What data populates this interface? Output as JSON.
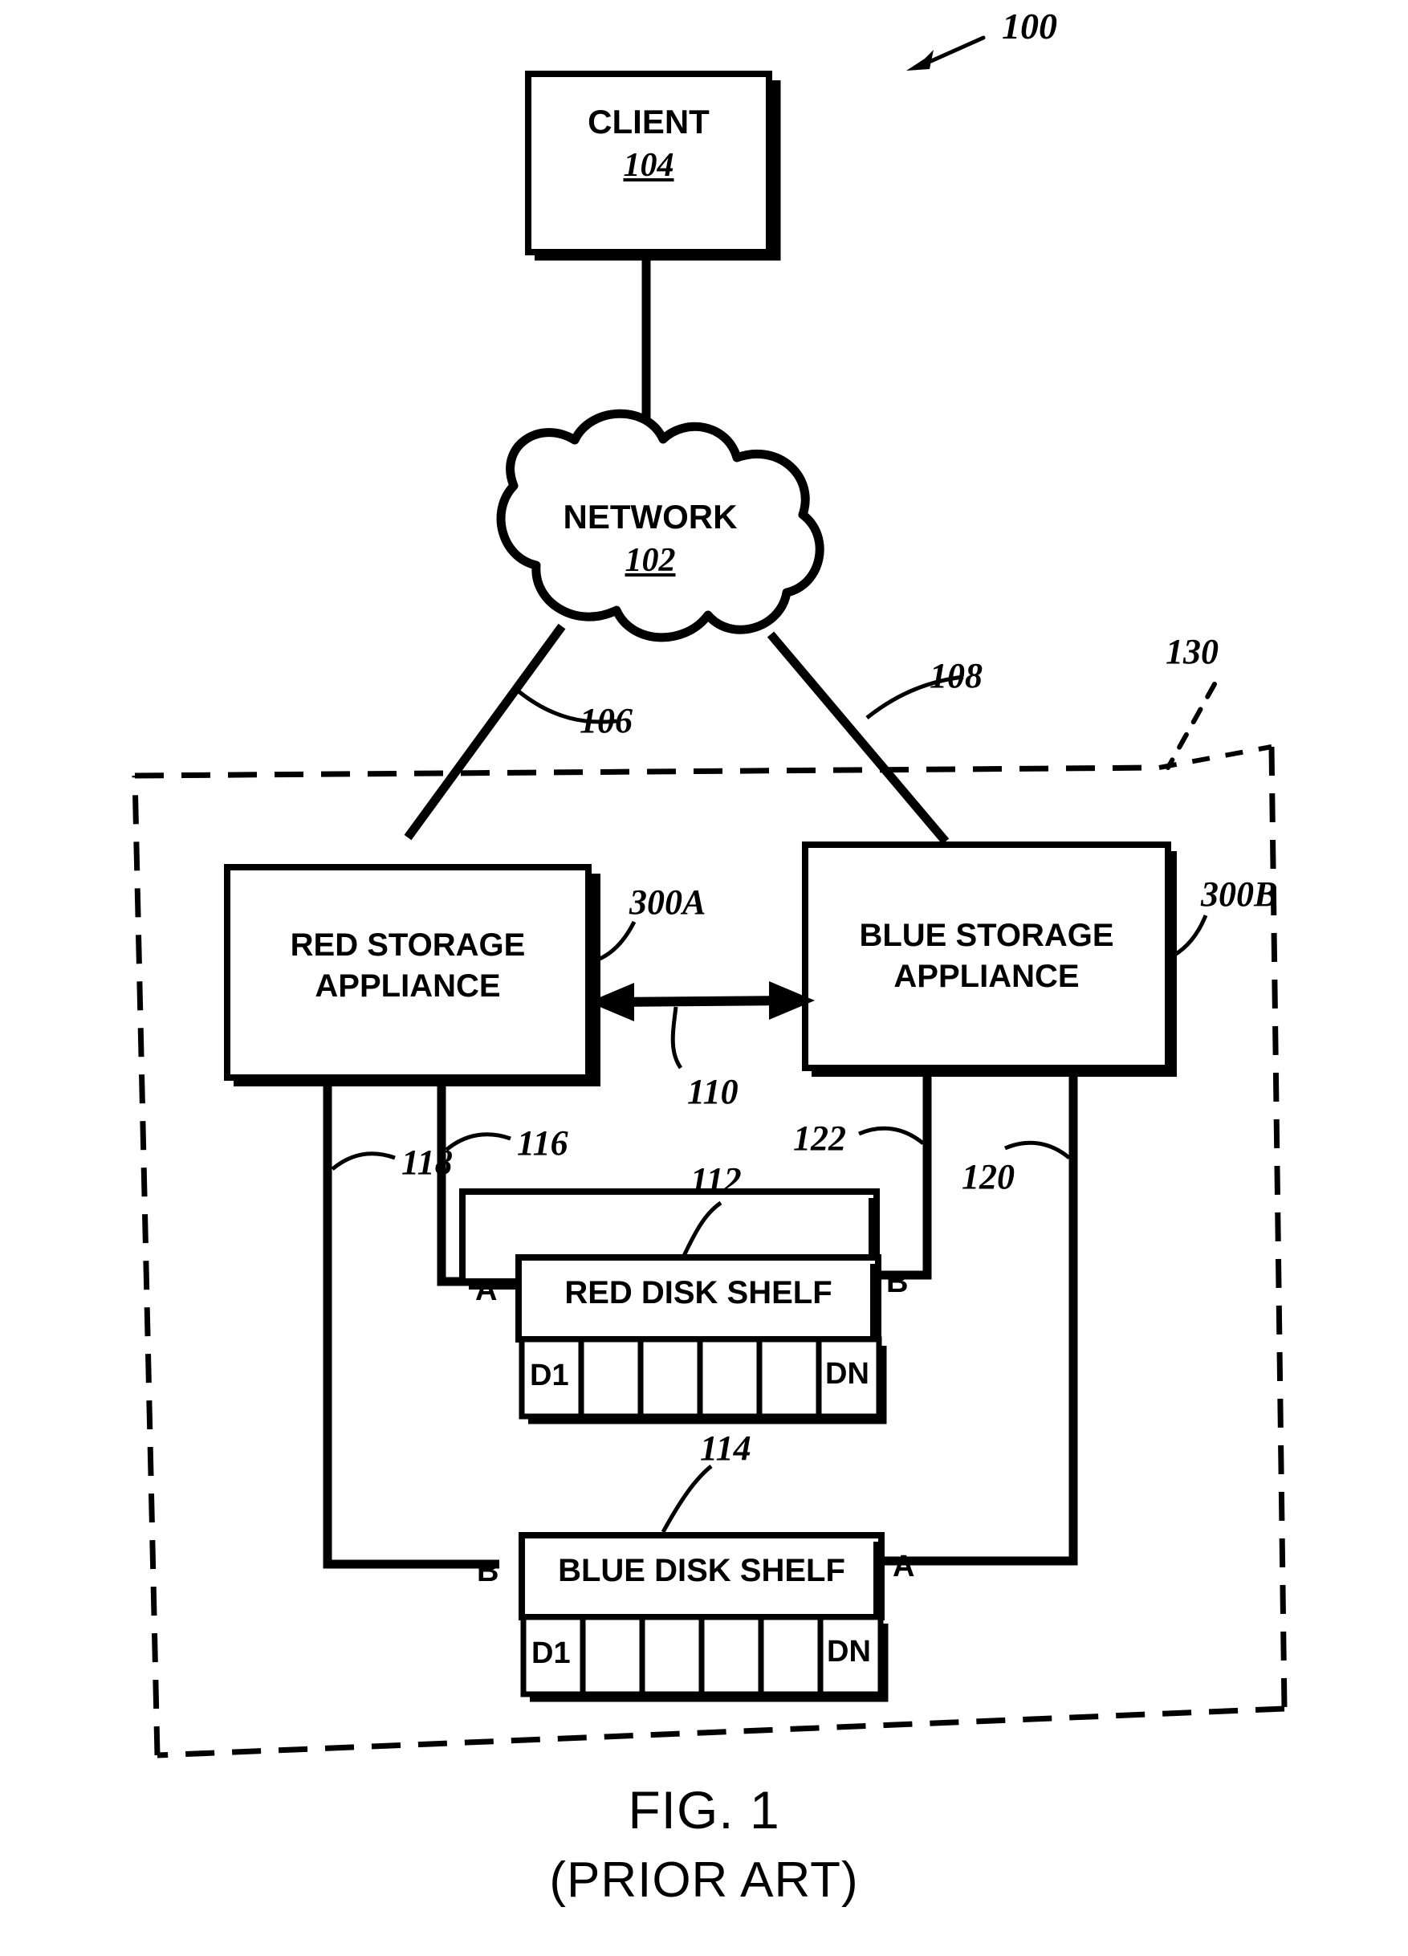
{
  "figure": {
    "number_label": "100",
    "caption_main": "FIG. 1",
    "caption_sub": "(PRIOR ART)"
  },
  "nodes": {
    "client": {
      "title": "CLIENT",
      "ref": "104"
    },
    "network": {
      "title": "NETWORK",
      "ref": "102"
    },
    "red_appliance": {
      "line1": "RED STORAGE",
      "line2": "APPLIANCE",
      "ref": "300A"
    },
    "blue_appliance": {
      "line1": "BLUE STORAGE",
      "line2": "APPLIANCE",
      "ref": "300B"
    },
    "red_shelf": {
      "title": "RED DISK SHELF",
      "ref": "112",
      "port_left": "A",
      "port_right": "B",
      "disks": [
        "D1",
        "",
        "",
        "",
        "",
        "DN"
      ]
    },
    "blue_shelf": {
      "title": "BLUE DISK SHELF",
      "ref": "114",
      "port_left": "B",
      "port_right": "A",
      "disks": [
        "D1",
        "",
        "",
        "",
        "",
        "DN"
      ]
    },
    "cluster_boundary": {
      "ref": "130"
    }
  },
  "connections": [
    {
      "ref": "106",
      "from": "network",
      "to": "red_appliance"
    },
    {
      "ref": "108",
      "from": "network",
      "to": "blue_appliance"
    },
    {
      "ref": "110",
      "from": "red_appliance",
      "to": "blue_appliance",
      "bidirectional": true
    },
    {
      "ref": "116",
      "from": "red_appliance",
      "to": "red_shelf_port_a"
    },
    {
      "ref": "118",
      "from": "red_appliance",
      "to": "blue_shelf_port_b"
    },
    {
      "ref": "122",
      "from": "blue_appliance",
      "to": "red_shelf_port_b"
    },
    {
      "ref": "120",
      "from": "blue_appliance",
      "to": "blue_shelf_port_a"
    }
  ],
  "colors": {
    "ink": "#000000",
    "paper": "#ffffff"
  }
}
